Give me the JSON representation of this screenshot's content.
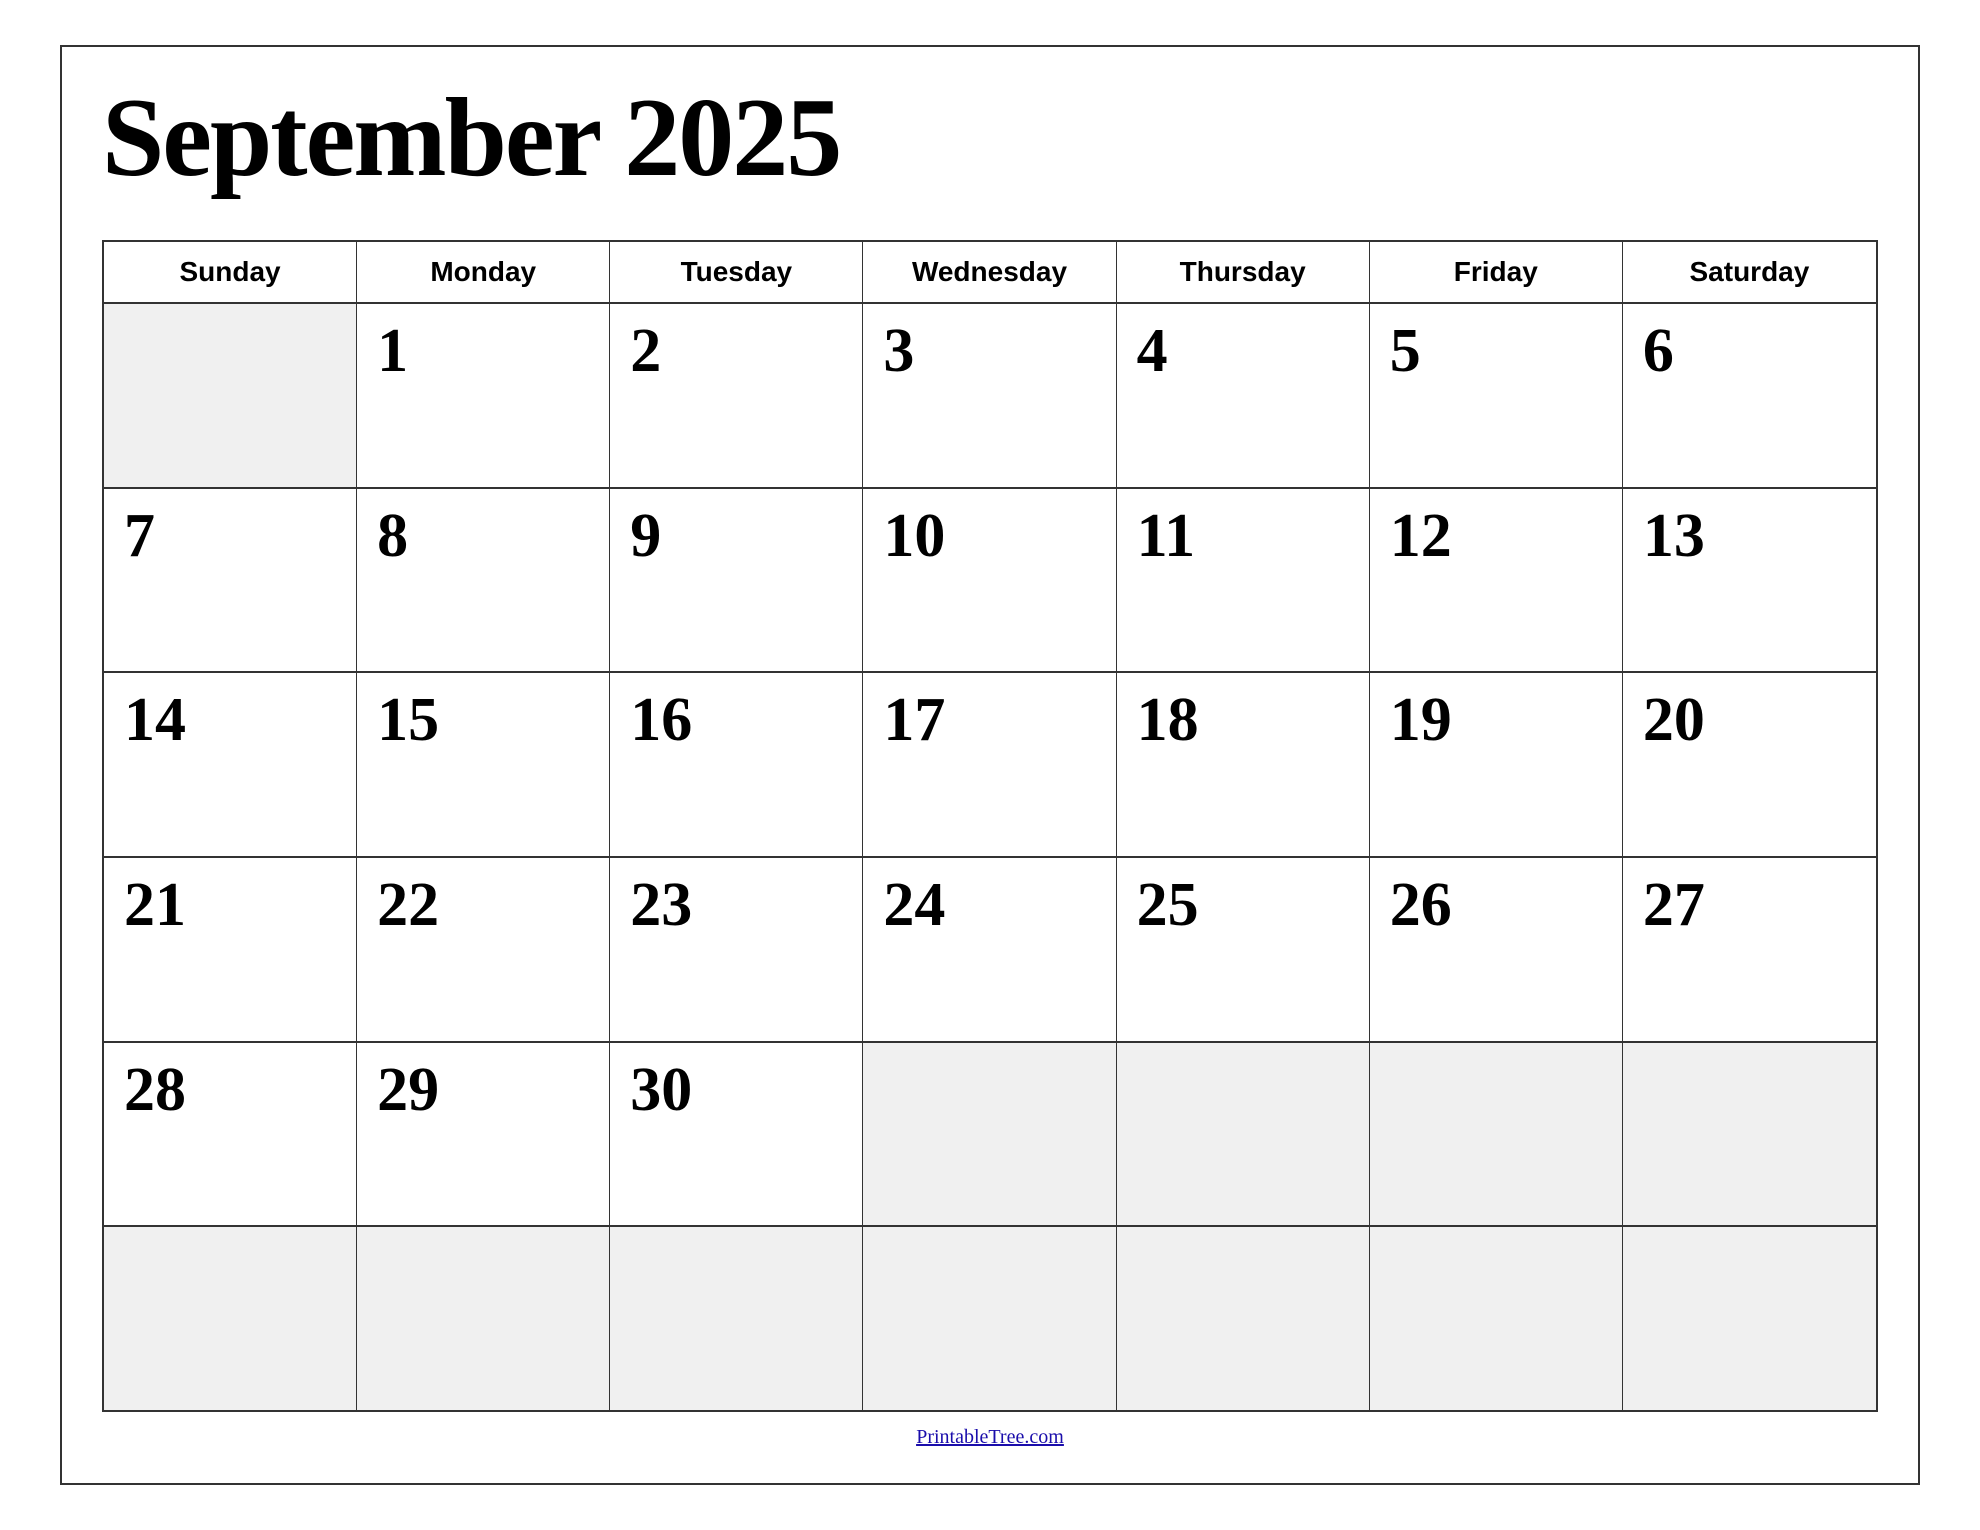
{
  "calendar": {
    "title": "September 2025",
    "headers": [
      "Sunday",
      "Monday",
      "Tuesday",
      "Wednesday",
      "Thursday",
      "Friday",
      "Saturday"
    ],
    "weeks": [
      [
        {
          "day": "",
          "empty": true
        },
        {
          "day": "1",
          "empty": false
        },
        {
          "day": "2",
          "empty": false
        },
        {
          "day": "3",
          "empty": false
        },
        {
          "day": "4",
          "empty": false
        },
        {
          "day": "5",
          "empty": false
        },
        {
          "day": "6",
          "empty": false
        }
      ],
      [
        {
          "day": "7",
          "empty": false
        },
        {
          "day": "8",
          "empty": false
        },
        {
          "day": "9",
          "empty": false
        },
        {
          "day": "10",
          "empty": false
        },
        {
          "day": "11",
          "empty": false
        },
        {
          "day": "12",
          "empty": false
        },
        {
          "day": "13",
          "empty": false
        }
      ],
      [
        {
          "day": "14",
          "empty": false
        },
        {
          "day": "15",
          "empty": false
        },
        {
          "day": "16",
          "empty": false
        },
        {
          "day": "17",
          "empty": false
        },
        {
          "day": "18",
          "empty": false
        },
        {
          "day": "19",
          "empty": false
        },
        {
          "day": "20",
          "empty": false
        }
      ],
      [
        {
          "day": "21",
          "empty": false
        },
        {
          "day": "22",
          "empty": false
        },
        {
          "day": "23",
          "empty": false
        },
        {
          "day": "24",
          "empty": false
        },
        {
          "day": "25",
          "empty": false
        },
        {
          "day": "26",
          "empty": false
        },
        {
          "day": "27",
          "empty": false
        }
      ],
      [
        {
          "day": "28",
          "empty": false
        },
        {
          "day": "29",
          "empty": false
        },
        {
          "day": "30",
          "empty": false
        },
        {
          "day": "",
          "empty": true
        },
        {
          "day": "",
          "empty": true
        },
        {
          "day": "",
          "empty": true
        },
        {
          "day": "",
          "empty": true
        }
      ],
      [
        {
          "day": "",
          "empty": true
        },
        {
          "day": "",
          "empty": true
        },
        {
          "day": "",
          "empty": true
        },
        {
          "day": "",
          "empty": true
        },
        {
          "day": "",
          "empty": true
        },
        {
          "day": "",
          "empty": true
        },
        {
          "day": "",
          "empty": true
        }
      ]
    ],
    "footer": {
      "link_text": "PrintableTree.com",
      "link_url": "https://PrintableTree.com"
    }
  }
}
